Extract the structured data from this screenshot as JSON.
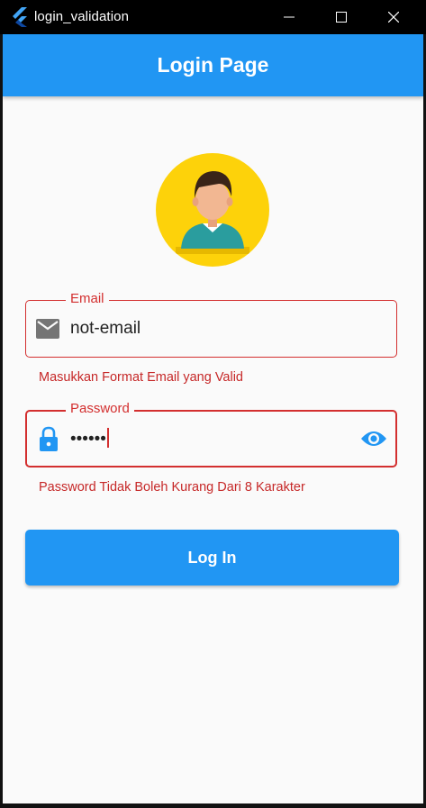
{
  "window": {
    "title": "login_validation"
  },
  "appbar": {
    "title": "Login Page"
  },
  "email_field": {
    "label": "Email",
    "value": "not-email",
    "error": "Masukkan Format Email yang Valid",
    "icon": "mail-icon"
  },
  "password_field": {
    "label": "Password",
    "value": "••••••",
    "error": "Password Tidak Boleh Kurang Dari 8 Karakter",
    "icon": "lock-icon",
    "toggle_icon": "eye-icon"
  },
  "login_button": {
    "label": "Log In"
  },
  "colors": {
    "primary": "#2196f3",
    "error": "#d32f2f",
    "avatar_bg": "#fdd20a",
    "background": "#fafafa"
  }
}
